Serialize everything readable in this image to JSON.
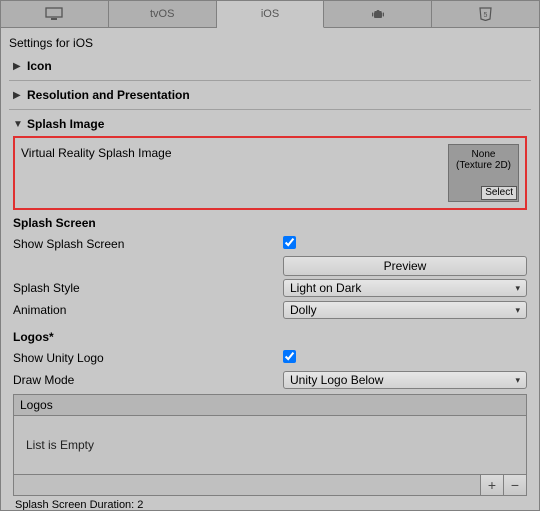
{
  "tabs": {
    "tvos": "tvOS",
    "ios": "iOS"
  },
  "settings_for": "Settings for iOS",
  "foldouts": {
    "icon": "Icon",
    "resolution": "Resolution and Presentation",
    "splash_image": "Splash Image"
  },
  "splash": {
    "vr_label": "Virtual Reality Splash Image",
    "tex_none": "None",
    "tex_type": "(Texture 2D)",
    "tex_select": "Select",
    "section_title": "Splash Screen",
    "show_label": "Show Splash Screen",
    "preview_btn": "Preview",
    "style_label": "Splash Style",
    "style_value": "Light on Dark",
    "anim_label": "Animation",
    "anim_value": "Dolly"
  },
  "logos": {
    "title": "Logos*",
    "show_unity_label": "Show Unity Logo",
    "draw_mode_label": "Draw Mode",
    "draw_mode_value": "Unity Logo Below",
    "list_header": "Logos",
    "empty_text": "List is Empty",
    "duration_label": "Splash Screen Duration: 2"
  }
}
